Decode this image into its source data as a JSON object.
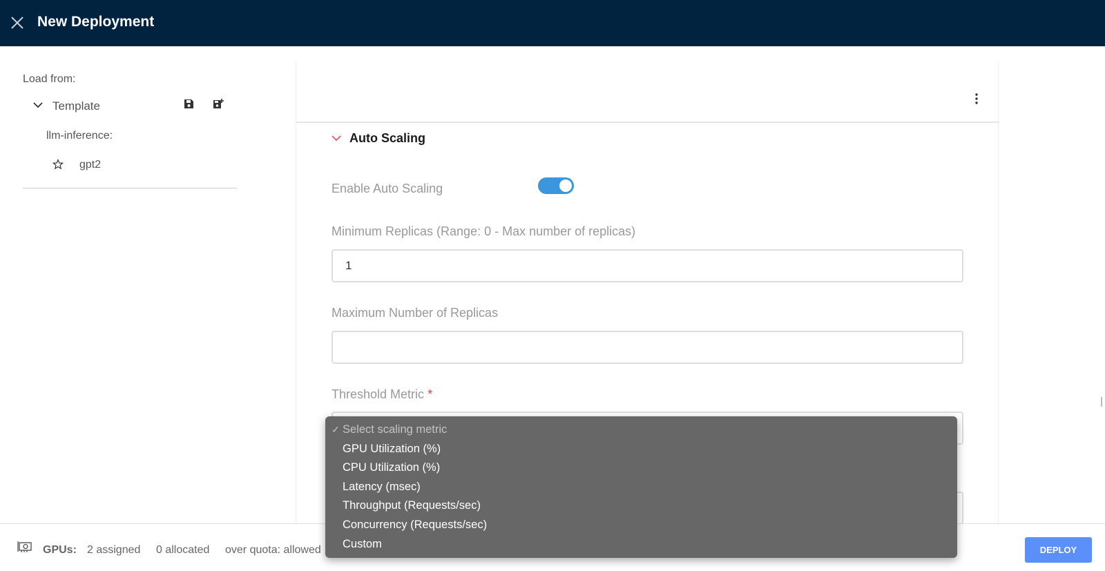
{
  "header": {
    "title": "New Deployment"
  },
  "sidebar": {
    "load_from_label": "Load from:",
    "template_label": "Template",
    "group_label": "llm-inference:",
    "items": [
      {
        "label": "gpt2"
      }
    ]
  },
  "auto_scaling": {
    "section_title": "Auto Scaling",
    "enable_label": "Enable Auto Scaling",
    "enabled": true,
    "min_replicas_label": "Minimum Replicas (Range: 0 - Max number of replicas)",
    "min_replicas_value": "1",
    "max_replicas_label": "Maximum Number of Replicas",
    "max_replicas_value": "",
    "threshold_metric_label": "Threshold Metric",
    "threshold_required_mark": "*",
    "threshold_options": [
      "Select scaling metric",
      "GPU Utilization (%)",
      "CPU Utilization (%)",
      "Latency (msec)",
      "Throughput (Requests/sec)",
      "Concurrency (Requests/sec)",
      "Custom"
    ],
    "threshold_selected": "Select scaling metric"
  },
  "footer": {
    "gpus_label": "GPUs:",
    "assigned_text": "2 assigned",
    "allocated_text": "0 allocated",
    "quota_text": "over quota: allowed",
    "deploy_label": "DEPLOY"
  },
  "colors": {
    "header_bg": "#012340",
    "toggle_on": "#3a96dd",
    "deploy_button": "#5b8ff9",
    "required_mark": "#e53e3e",
    "dropdown_bg": "#686767"
  }
}
